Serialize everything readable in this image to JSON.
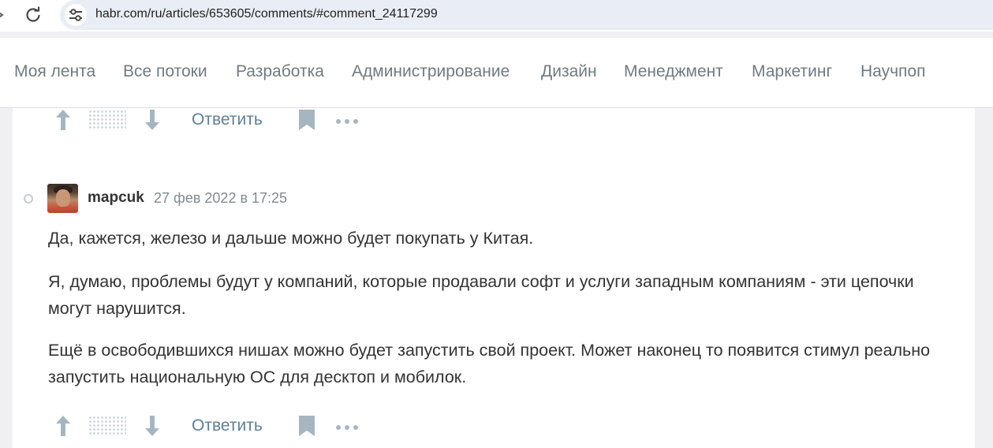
{
  "browser": {
    "url_host": "habr.com",
    "url_path": "/ru/articles/653605/comments/#comment_24117299"
  },
  "nav": {
    "items": [
      "Моя лента",
      "Все потоки",
      "Разработка",
      "Администрирование",
      "Дизайн",
      "Менеджмент",
      "Маркетинг",
      "Научпоп"
    ]
  },
  "comment_actions": {
    "reply_label": "Ответить"
  },
  "comment": {
    "author": "mapcuk",
    "timestamp": "27 фев 2022 в 17:25",
    "paragraphs": [
      "Да, кажется, железо и дальше можно будет покупать у Китая.",
      "Я, думаю, проблемы будут у компаний, которые продавали софт и услуги западным компаниям - эти цепочки могут нарушится.",
      "Ещё в освободившихся нишах можно будет запустить свой проект. Может наконец то появится стимул реально запустить национальную ОС для десктоп и мобилок."
    ]
  },
  "colors": {
    "nav_text": "#707a81",
    "link": "#5e7f99",
    "vote_icon": "#a6b6c1",
    "body_text": "#333333"
  }
}
